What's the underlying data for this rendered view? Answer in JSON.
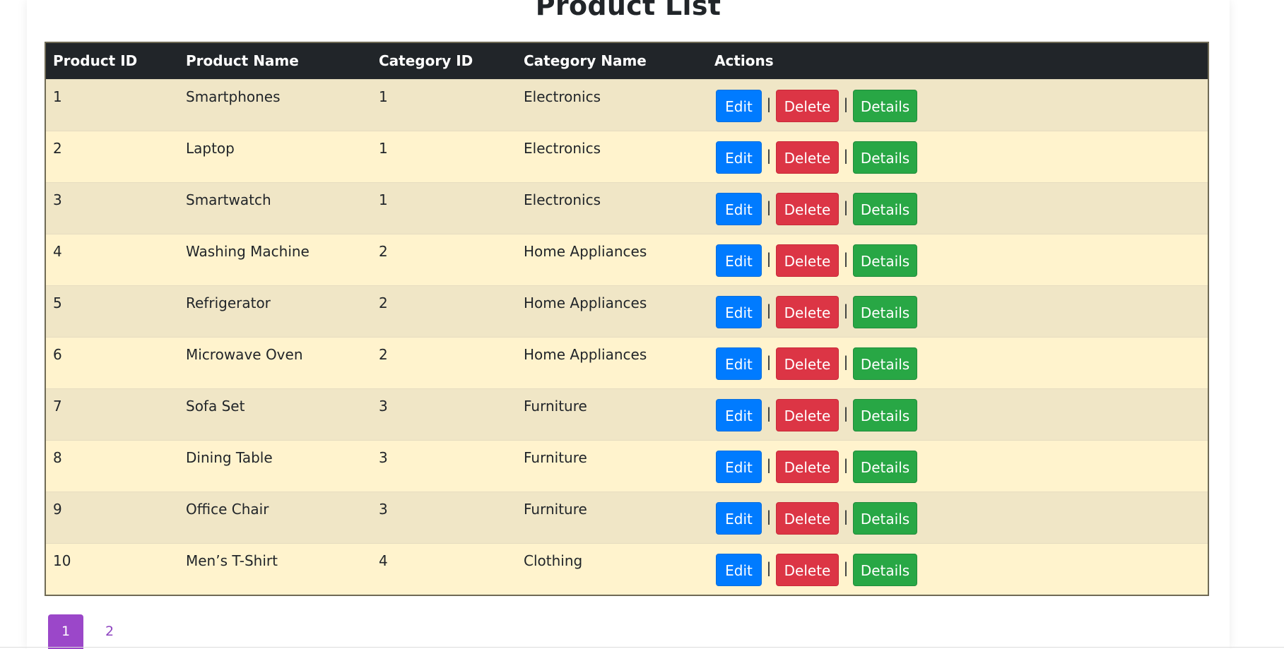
{
  "page": {
    "title": "Product List"
  },
  "table": {
    "headers": [
      "Product ID",
      "Product Name",
      "Category ID",
      "Category Name",
      "Actions"
    ],
    "rows": [
      {
        "id": "1",
        "name": "Smartphones",
        "category_id": "1",
        "category_name": "Electronics"
      },
      {
        "id": "2",
        "name": "Laptop",
        "category_id": "1",
        "category_name": "Electronics"
      },
      {
        "id": "3",
        "name": "Smartwatch",
        "category_id": "1",
        "category_name": "Electronics"
      },
      {
        "id": "4",
        "name": "Washing Machine",
        "category_id": "2",
        "category_name": "Home Appliances"
      },
      {
        "id": "5",
        "name": "Refrigerator",
        "category_id": "2",
        "category_name": "Home Appliances"
      },
      {
        "id": "6",
        "name": "Microwave Oven",
        "category_id": "2",
        "category_name": "Home Appliances"
      },
      {
        "id": "7",
        "name": "Sofa Set",
        "category_id": "3",
        "category_name": "Furniture"
      },
      {
        "id": "8",
        "name": "Dining Table",
        "category_id": "3",
        "category_name": "Furniture"
      },
      {
        "id": "9",
        "name": "Office Chair",
        "category_id": "3",
        "category_name": "Furniture"
      },
      {
        "id": "10",
        "name": "Men’s T-Shirt",
        "category_id": "4",
        "category_name": "Clothing"
      }
    ],
    "actions": {
      "edit_label": "Edit",
      "delete_label": "Delete",
      "details_label": "Details",
      "separator": "|"
    }
  },
  "pagination": {
    "pages": [
      "1",
      "2"
    ],
    "active": "1"
  },
  "colors": {
    "header_bg": "#212529",
    "row_odd": "#f0e6c6",
    "row_even": "#fff3cd",
    "edit": "#007bff",
    "delete": "#dc3545",
    "details": "#28a745",
    "page_active": "#9b47c9"
  }
}
